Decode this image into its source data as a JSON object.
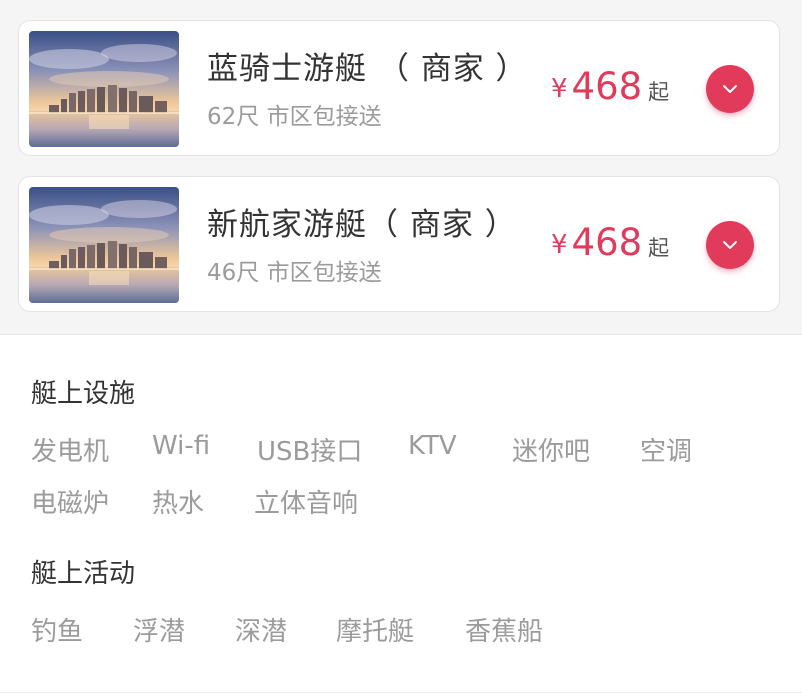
{
  "listings": [
    {
      "name": "蓝骑士游艇 （ 商家 ）",
      "subtitle": "62尺 市区包接送",
      "currency": "¥",
      "price": "468",
      "price_suffix": "起",
      "thumbnail": "city-skyline-waterfront-photo"
    },
    {
      "name": "新航家游艇（ 商家 ）",
      "subtitle": "46尺 市区包接送",
      "currency": "¥",
      "price": "468",
      "price_suffix": "起",
      "thumbnail": "city-skyline-waterfront-photo"
    }
  ],
  "facilities": {
    "title": "艇上设施",
    "items": [
      "发电机",
      "Wi-fi",
      "USB接口",
      "KTV",
      "迷你吧",
      "空调",
      "电磁炉",
      "热水",
      "立体音响"
    ]
  },
  "activities": {
    "title": "艇上活动",
    "items": [
      "钓鱼",
      "浮潜",
      "深潜",
      "摩托艇",
      "香蕉船"
    ]
  },
  "colors": {
    "accent": "#e23a5b",
    "muted_text": "#9b9b9b",
    "primary_text": "#333333",
    "background": "#f5f5f5"
  },
  "icons": {
    "expand": "chevron-down-icon"
  }
}
